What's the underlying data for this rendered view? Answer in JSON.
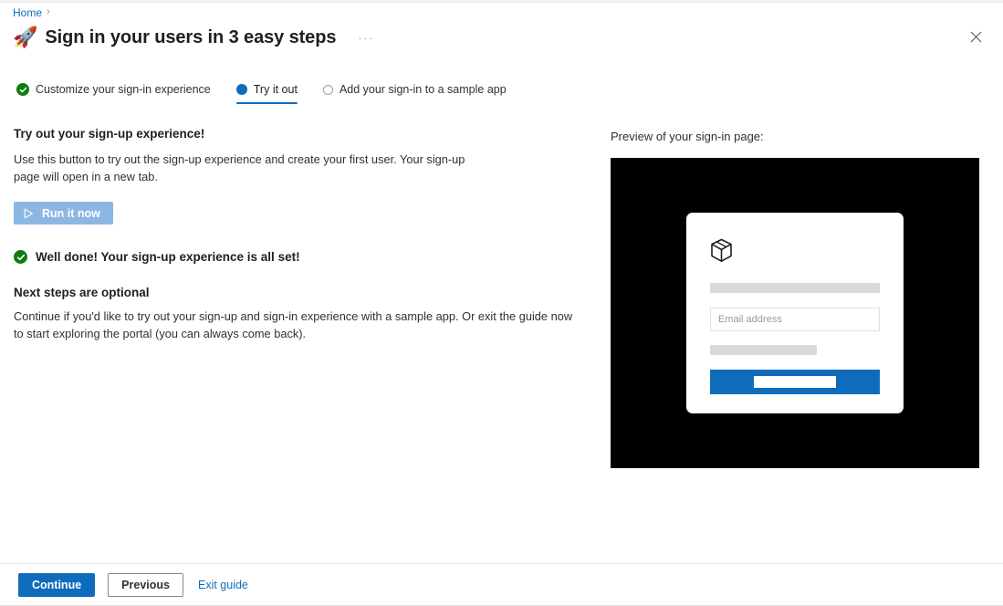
{
  "window": {
    "close_icon": "close-icon"
  },
  "breadcrumb": {
    "home_label": "Home",
    "separator": "›"
  },
  "header": {
    "rocket_icon": "🚀",
    "title": "Sign in your users in 3 easy steps",
    "ellipsis_label": "···"
  },
  "steps": [
    {
      "label": "Customize your sign-in experience",
      "state": "completed",
      "icon": "check-circle-icon"
    },
    {
      "label": "Try it out",
      "state": "active",
      "icon": "radio-filled-icon"
    },
    {
      "label": "Add your sign-in to a sample app",
      "state": "upcoming",
      "icon": "radio-empty-icon"
    }
  ],
  "main": {
    "section_heading": "Try out your sign-up experience!",
    "section_body": "Use this button to try out the sign-up experience and create your first user. Your sign-up page will open in a new tab.",
    "run_button": {
      "label": "Run it now",
      "icon": "play-icon",
      "disabled": true
    },
    "success": {
      "icon": "check-circle-icon",
      "text": "Well done! Your sign-up experience is all set!"
    },
    "next_steps_heading": "Next steps are optional",
    "next_steps_body": "Continue if you'd like to try out your sign-up and sign-in experience with a sample app. Or exit the guide now to start exploring the portal (you can always come back)."
  },
  "preview": {
    "label": "Preview of your sign-in page:",
    "logo_icon": "cube-box-icon",
    "email_placeholder": "Email address",
    "background_color": "#000000",
    "card_color": "#ffffff",
    "submit_color": "#0f6cbd",
    "skeleton_color": "#d9d9d9"
  },
  "footer": {
    "continue_label": "Continue",
    "previous_label": "Previous",
    "exit_label": "Exit guide"
  },
  "colors": {
    "accent": "#0f6cbd",
    "success": "#107c10",
    "disabled_button": "#8cb7e2",
    "text": "#323130"
  }
}
